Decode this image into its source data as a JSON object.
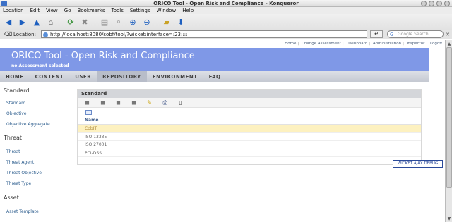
{
  "window": {
    "title": "ORICO Tool - Open Risk and Compliance - Konqueror"
  },
  "menubar": [
    "Location",
    "Edit",
    "View",
    "Go",
    "Bookmarks",
    "Tools",
    "Settings",
    "Window",
    "Help"
  ],
  "toolbar": {
    "icons": [
      "back-icon",
      "forward-icon",
      "up-icon",
      "home-icon",
      "reload-icon",
      "stop-icon",
      "print-icon",
      "find-icon",
      "zoom-in-icon",
      "zoom-out-icon",
      "bookmark-folder-icon",
      "download-icon"
    ]
  },
  "locationbar": {
    "label": "Location:",
    "url": "http://localhost:8080/sobf/tool/?wicket:interface=:23::::",
    "search_placeholder": "Google Search"
  },
  "page": {
    "topnav": [
      "Home",
      "Change Assessment",
      "Dashboard",
      "Administration",
      "Inspector",
      "Logoff"
    ],
    "banner_title": "ORICO Tool - Open Risk and Compliance",
    "banner_subtitle": "no Assessment selected",
    "tabs": [
      "HOME",
      "CONTENT",
      "USER",
      "REPOSITORY",
      "ENVIRONMENT",
      "FAQ"
    ],
    "active_tab": "REPOSITORY",
    "sidebar": {
      "standard_title": "Standard",
      "standard_items": [
        "Standard",
        "Objective",
        "Objective Aggregate"
      ],
      "threat_title": "Threat",
      "threat_items": [
        "Threat",
        "Threat Agent",
        "Threat Objective",
        "Threat Type"
      ],
      "asset_title": "Asset",
      "asset_items": [
        "Asset Template"
      ]
    },
    "panel": {
      "title": "Standard",
      "column_header": "Name",
      "rows": [
        "CobIT",
        "ISO 13335",
        "ISO 27001",
        "PCI-DSS"
      ],
      "selected_row": "CobIT"
    },
    "ajax_debug": "WICKET AJAX DEBUG"
  },
  "colors": {
    "banner": "#7f98e7",
    "selected_row": "#fdf1c0",
    "link": "#2f5f8f"
  }
}
